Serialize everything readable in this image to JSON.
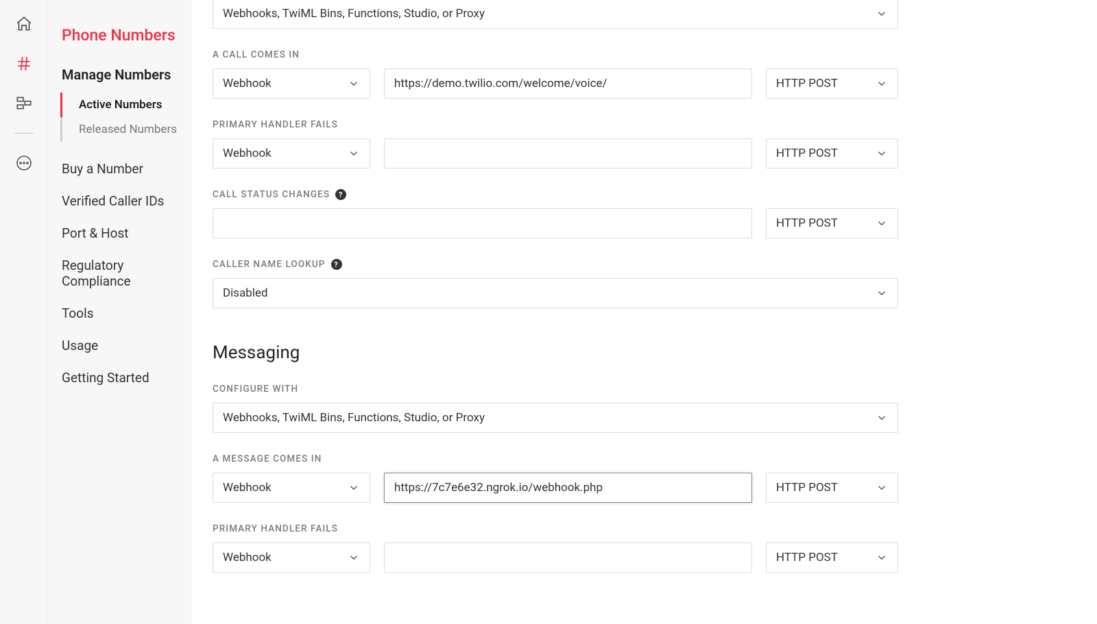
{
  "sidebar": {
    "title": "Phone Numbers",
    "section": "Manage Numbers",
    "subitems": [
      {
        "label": "Active Numbers"
      },
      {
        "label": "Released Numbers"
      }
    ],
    "items": [
      {
        "label": "Buy a Number"
      },
      {
        "label": "Verified Caller IDs"
      },
      {
        "label": "Port & Host"
      },
      {
        "label": "Regulatory Compliance"
      },
      {
        "label": "Tools"
      },
      {
        "label": "Usage"
      },
      {
        "label": "Getting Started"
      }
    ]
  },
  "voice": {
    "configure_with_value": "Webhooks, TwiML Bins, Functions, Studio, or Proxy",
    "call_comes_in_label": "A CALL COMES IN",
    "call_comes_in_type": "Webhook",
    "call_comes_in_url": "https://demo.twilio.com/welcome/voice/",
    "call_comes_in_method": "HTTP POST",
    "primary_fails_label": "PRIMARY HANDLER FAILS",
    "primary_fails_type": "Webhook",
    "primary_fails_url": "",
    "primary_fails_method": "HTTP POST",
    "status_changes_label": "CALL STATUS CHANGES",
    "status_changes_url": "",
    "status_changes_method": "HTTP POST",
    "caller_lookup_label": "CALLER NAME LOOKUP",
    "caller_lookup_value": "Disabled"
  },
  "messaging": {
    "heading": "Messaging",
    "configure_with_label": "CONFIGURE WITH",
    "configure_with_value": "Webhooks, TwiML Bins, Functions, Studio, or Proxy",
    "message_comes_in_label": "A MESSAGE COMES IN",
    "message_comes_in_type": "Webhook",
    "message_comes_in_url": "https://7c7e6e32.ngrok.io/webhook.php",
    "message_comes_in_method": "HTTP POST",
    "primary_fails_label": "PRIMARY HANDLER FAILS",
    "primary_fails_type": "Webhook",
    "primary_fails_url": "",
    "primary_fails_method": "HTTP POST"
  }
}
